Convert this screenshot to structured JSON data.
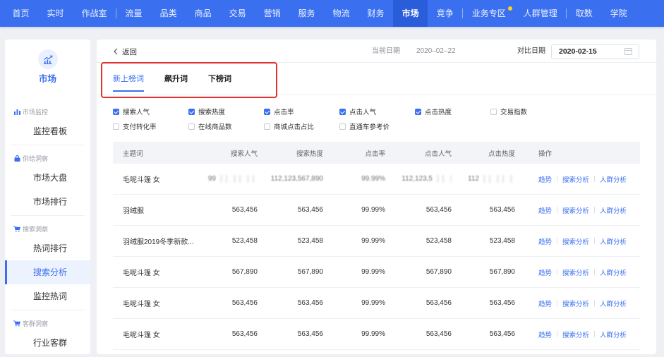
{
  "colors": {
    "primary": "#3a6ff0",
    "nav_bg": "#3a70f0",
    "nav_active_bg": "#2a5dd9",
    "highlight_border": "#e0322f",
    "badge_dot": "#ffd21f"
  },
  "nav": {
    "groups": [
      [
        {
          "label": "首页"
        },
        {
          "label": "实时"
        },
        {
          "label": "作战室"
        }
      ],
      [
        {
          "label": "流量"
        },
        {
          "label": "品类"
        },
        {
          "label": "商品"
        },
        {
          "label": "交易"
        },
        {
          "label": "营销"
        },
        {
          "label": "服务"
        },
        {
          "label": "物流"
        },
        {
          "label": "财务"
        },
        {
          "label": "市场",
          "active": true
        },
        {
          "label": "竞争"
        }
      ],
      [
        {
          "label": "业务专区",
          "badge": "dot"
        },
        {
          "label": "人群管理"
        }
      ],
      [
        {
          "label": "取数"
        },
        {
          "label": "学院"
        }
      ]
    ]
  },
  "sidebar": {
    "module_icon": "trend-chart-icon",
    "module_title": "市场",
    "groups": [
      {
        "title": "市场监控",
        "icon": "bar-chart-icon",
        "items": [
          {
            "label": "监控看板"
          }
        ]
      },
      {
        "title": "供给洞察",
        "icon": "bag-icon",
        "items": [
          {
            "label": "市场大盘"
          },
          {
            "label": "市场排行"
          }
        ]
      },
      {
        "title": "搜索洞察",
        "icon": "cart-icon",
        "items": [
          {
            "label": "热词排行"
          },
          {
            "label": "搜索分析",
            "active": true
          },
          {
            "label": "监控热词"
          }
        ]
      },
      {
        "title": "客群洞察",
        "icon": "cart-icon",
        "items": [
          {
            "label": "行业客群"
          }
        ]
      }
    ]
  },
  "header": {
    "back_label": "返回",
    "current_date_label": "当前日期",
    "current_date": "2020–02–22",
    "compare_date_label": "对比日期",
    "compare_date": "2020-02-15"
  },
  "tabs": [
    {
      "label": "新上榜词",
      "active": true
    },
    {
      "label": "飙升词"
    },
    {
      "label": "下榜词"
    }
  ],
  "filters": [
    {
      "label": "搜索人气",
      "checked": true
    },
    {
      "label": "搜索热度",
      "checked": true
    },
    {
      "label": "点击率",
      "checked": true
    },
    {
      "label": "点击人气",
      "checked": true
    },
    {
      "label": "点击热度",
      "checked": true
    },
    {
      "label": "交易指数",
      "checked": false
    },
    {
      "label": "支付转化率",
      "checked": false
    },
    {
      "label": "在线商品数",
      "checked": false
    },
    {
      "label": "商城点击占比",
      "checked": false
    },
    {
      "label": "直通车参考价",
      "checked": false
    }
  ],
  "table": {
    "columns": [
      "主题词",
      "搜索人气",
      "搜索热度",
      "点击率",
      "点击人气",
      "点击热度",
      "操作"
    ],
    "actions": [
      "趋势",
      "搜索分析",
      "人群分析"
    ],
    "rows": [
      {
        "keyword": "毛呢斗篷 女",
        "search_popularity": "99",
        "search_heat": "112,123,567,890",
        "click_rate": "99.99%",
        "click_popularity": "112,123,5",
        "click_heat": "112",
        "obscured": true
      },
      {
        "keyword": "羽绒服",
        "search_popularity": "563,456",
        "search_heat": "563,456",
        "click_rate": "99.99%",
        "click_popularity": "563,456",
        "click_heat": "563,456"
      },
      {
        "keyword": "羽绒服2019冬季新款...",
        "search_popularity": "523,458",
        "search_heat": "523,458",
        "click_rate": "99.99%",
        "click_popularity": "523,458",
        "click_heat": "523,458"
      },
      {
        "keyword": "毛呢斗篷 女",
        "search_popularity": "567,890",
        "search_heat": "567,890",
        "click_rate": "99.99%",
        "click_popularity": "567,890",
        "click_heat": "567,890"
      },
      {
        "keyword": "毛呢斗篷 女",
        "search_popularity": "563,456",
        "search_heat": "563,456",
        "click_rate": "99.99%",
        "click_popularity": "563,456",
        "click_heat": "563,456"
      },
      {
        "keyword": "毛呢斗篷 女",
        "search_popularity": "563,456",
        "search_heat": "563,456",
        "click_rate": "99.99%",
        "click_popularity": "563,456",
        "click_heat": "563,456"
      }
    ]
  }
}
